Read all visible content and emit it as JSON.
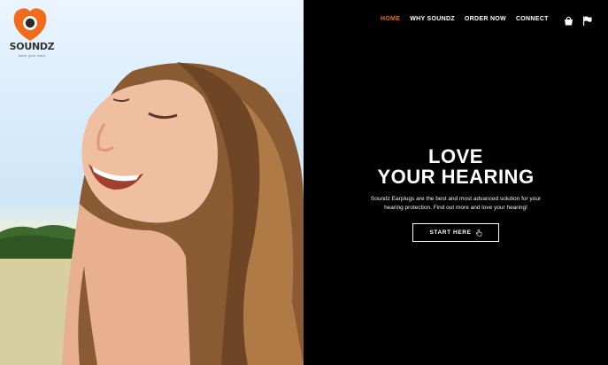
{
  "brand": {
    "name": "SOUNDZ",
    "tagline": "save your ears",
    "accent_color": "#f26a1b"
  },
  "nav": {
    "items": [
      {
        "label": "HOME",
        "active": true
      },
      {
        "label": "WHY SOUNDZ",
        "active": false
      },
      {
        "label": "ORDER NOW",
        "active": false
      },
      {
        "label": "CONNECT",
        "active": false
      }
    ],
    "icons": [
      "shopping-bag-icon",
      "flag-icon"
    ]
  },
  "hero": {
    "title_line1": "LOVE",
    "title_line2": "YOUR HEARING",
    "description": "Soundz Earplugs are the best and most advanced solution for your hearing protection. Find out more and love your hearing!",
    "cta_label": "START HERE",
    "cta_icon": "pointer-hand-icon"
  },
  "colors": {
    "background_right": "#000000",
    "text": "#ffffff",
    "active_nav": "#f26a1b"
  }
}
